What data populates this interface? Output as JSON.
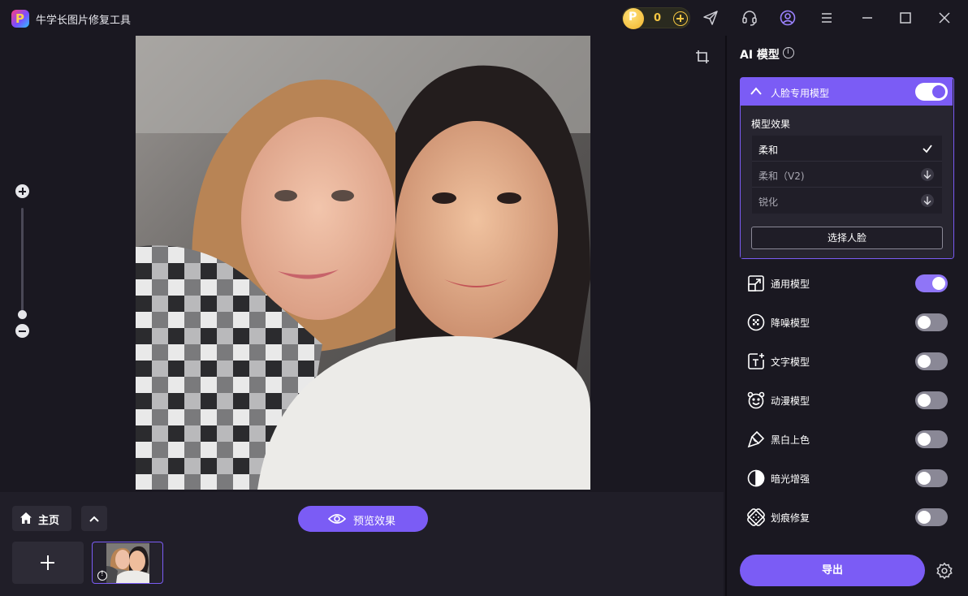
{
  "app": {
    "title": "牛学长图片修复工具"
  },
  "header": {
    "coin_count": "0"
  },
  "panel": {
    "title": "AI 模型",
    "face_model": {
      "label": "人脸专用模型",
      "enabled": true,
      "effect_label": "模型效果",
      "options": [
        {
          "label": "柔和",
          "state": "selected"
        },
        {
          "label": "柔和（V2)",
          "state": "download"
        },
        {
          "label": "锐化",
          "state": "download"
        }
      ],
      "select_face_label": "选择人脸"
    },
    "models": [
      {
        "label": "通用模型",
        "icon": "upscale-icon",
        "enabled": true
      },
      {
        "label": "降噪模型",
        "icon": "denoise-icon",
        "enabled": false
      },
      {
        "label": "文字模型",
        "icon": "text-icon",
        "enabled": false
      },
      {
        "label": "动漫模型",
        "icon": "anime-icon",
        "enabled": false
      },
      {
        "label": "黑白上色",
        "icon": "colorize-icon",
        "enabled": false
      },
      {
        "label": "暗光增强",
        "icon": "lowlight-icon",
        "enabled": false
      },
      {
        "label": "划痕修复",
        "icon": "scratch-icon",
        "enabled": false
      }
    ],
    "export_label": "导出"
  },
  "bottom": {
    "home_label": "主页",
    "preview_label": "预览效果"
  },
  "colors": {
    "accent": "#7b5cf5",
    "background": "#1a1821",
    "coin": "#f4c542"
  }
}
